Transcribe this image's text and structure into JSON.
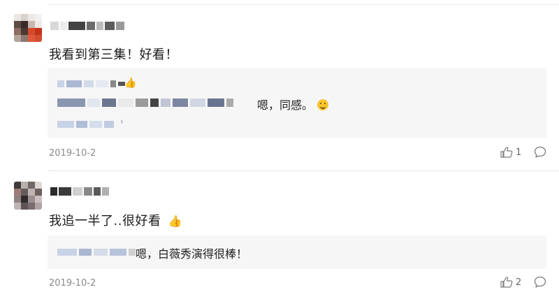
{
  "comments": [
    {
      "text": "我看到第三集！好看！",
      "reply_1_text": "嗯，同感。",
      "reply_1_emoji": "smile-emoji",
      "date": "2019-10-2",
      "like_count": "1"
    },
    {
      "text": "我追一半了..很好看",
      "text_emoji": "thumbs-up-emoji",
      "reply_1_text": "嗯，白薇秀演得很棒！",
      "date": "2019-10-2",
      "like_count": "2"
    }
  ],
  "icons": {
    "like": "thumbs-up-outline-icon",
    "comment": "speech-bubble-icon",
    "more": "chevron-right-icon"
  },
  "colors": {
    "reply_bg": "#f6f6f6",
    "meta_text": "#8a8a8a"
  }
}
